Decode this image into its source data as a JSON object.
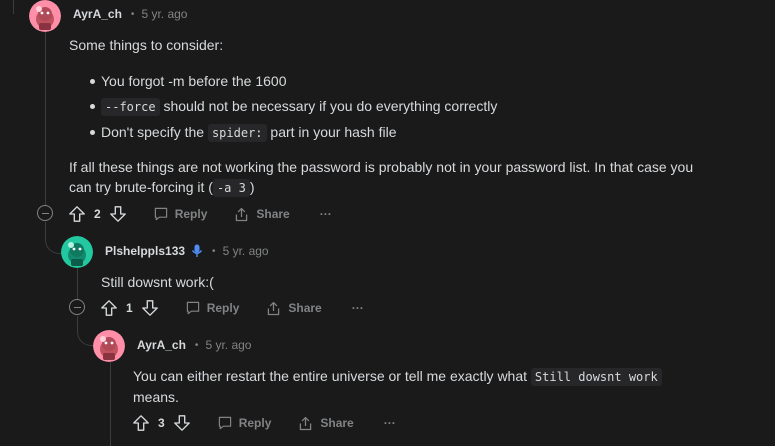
{
  "comments": [
    {
      "username": "AyrA_ch",
      "time": "5 yr. ago",
      "intro": "Some things to consider:",
      "bullets": [
        {
          "pre": "You forgot -m before the 1600",
          "code": "",
          "post": ""
        },
        {
          "pre": "",
          "code": "--force",
          "post": " should not be necessary if you do everything correctly"
        },
        {
          "pre": "Don't specify the ",
          "code": "spider:",
          "post": " part in your hash file"
        }
      ],
      "outro_pre": "If all these things are not working the password is probably not in your password list. In that case you can try brute-forcing it (",
      "outro_code": "-a 3",
      "outro_post": ")",
      "votes": "2",
      "reply_label": "Reply",
      "share_label": "Share",
      "more_label": "···"
    },
    {
      "username": "Plshelppls133",
      "time": "5 yr. ago",
      "body": "Still dowsnt work:(",
      "votes": "1",
      "reply_label": "Reply",
      "share_label": "Share",
      "more_label": "···"
    },
    {
      "username": "AyrA_ch",
      "time": "5 yr. ago",
      "body_pre": "You can either restart the entire universe or tell me exactly what ",
      "body_code": "Still dowsnt work",
      "body_post": " means.",
      "votes": "3",
      "reply_label": "Reply",
      "share_label": "Share",
      "more_label": "···"
    }
  ],
  "separator": "•",
  "colors": {
    "background": "#1a1a1b",
    "avatar_pink": "#ff8fa8",
    "avatar_teal": "#24c8a0",
    "mic_blue": "#4f8df5"
  }
}
